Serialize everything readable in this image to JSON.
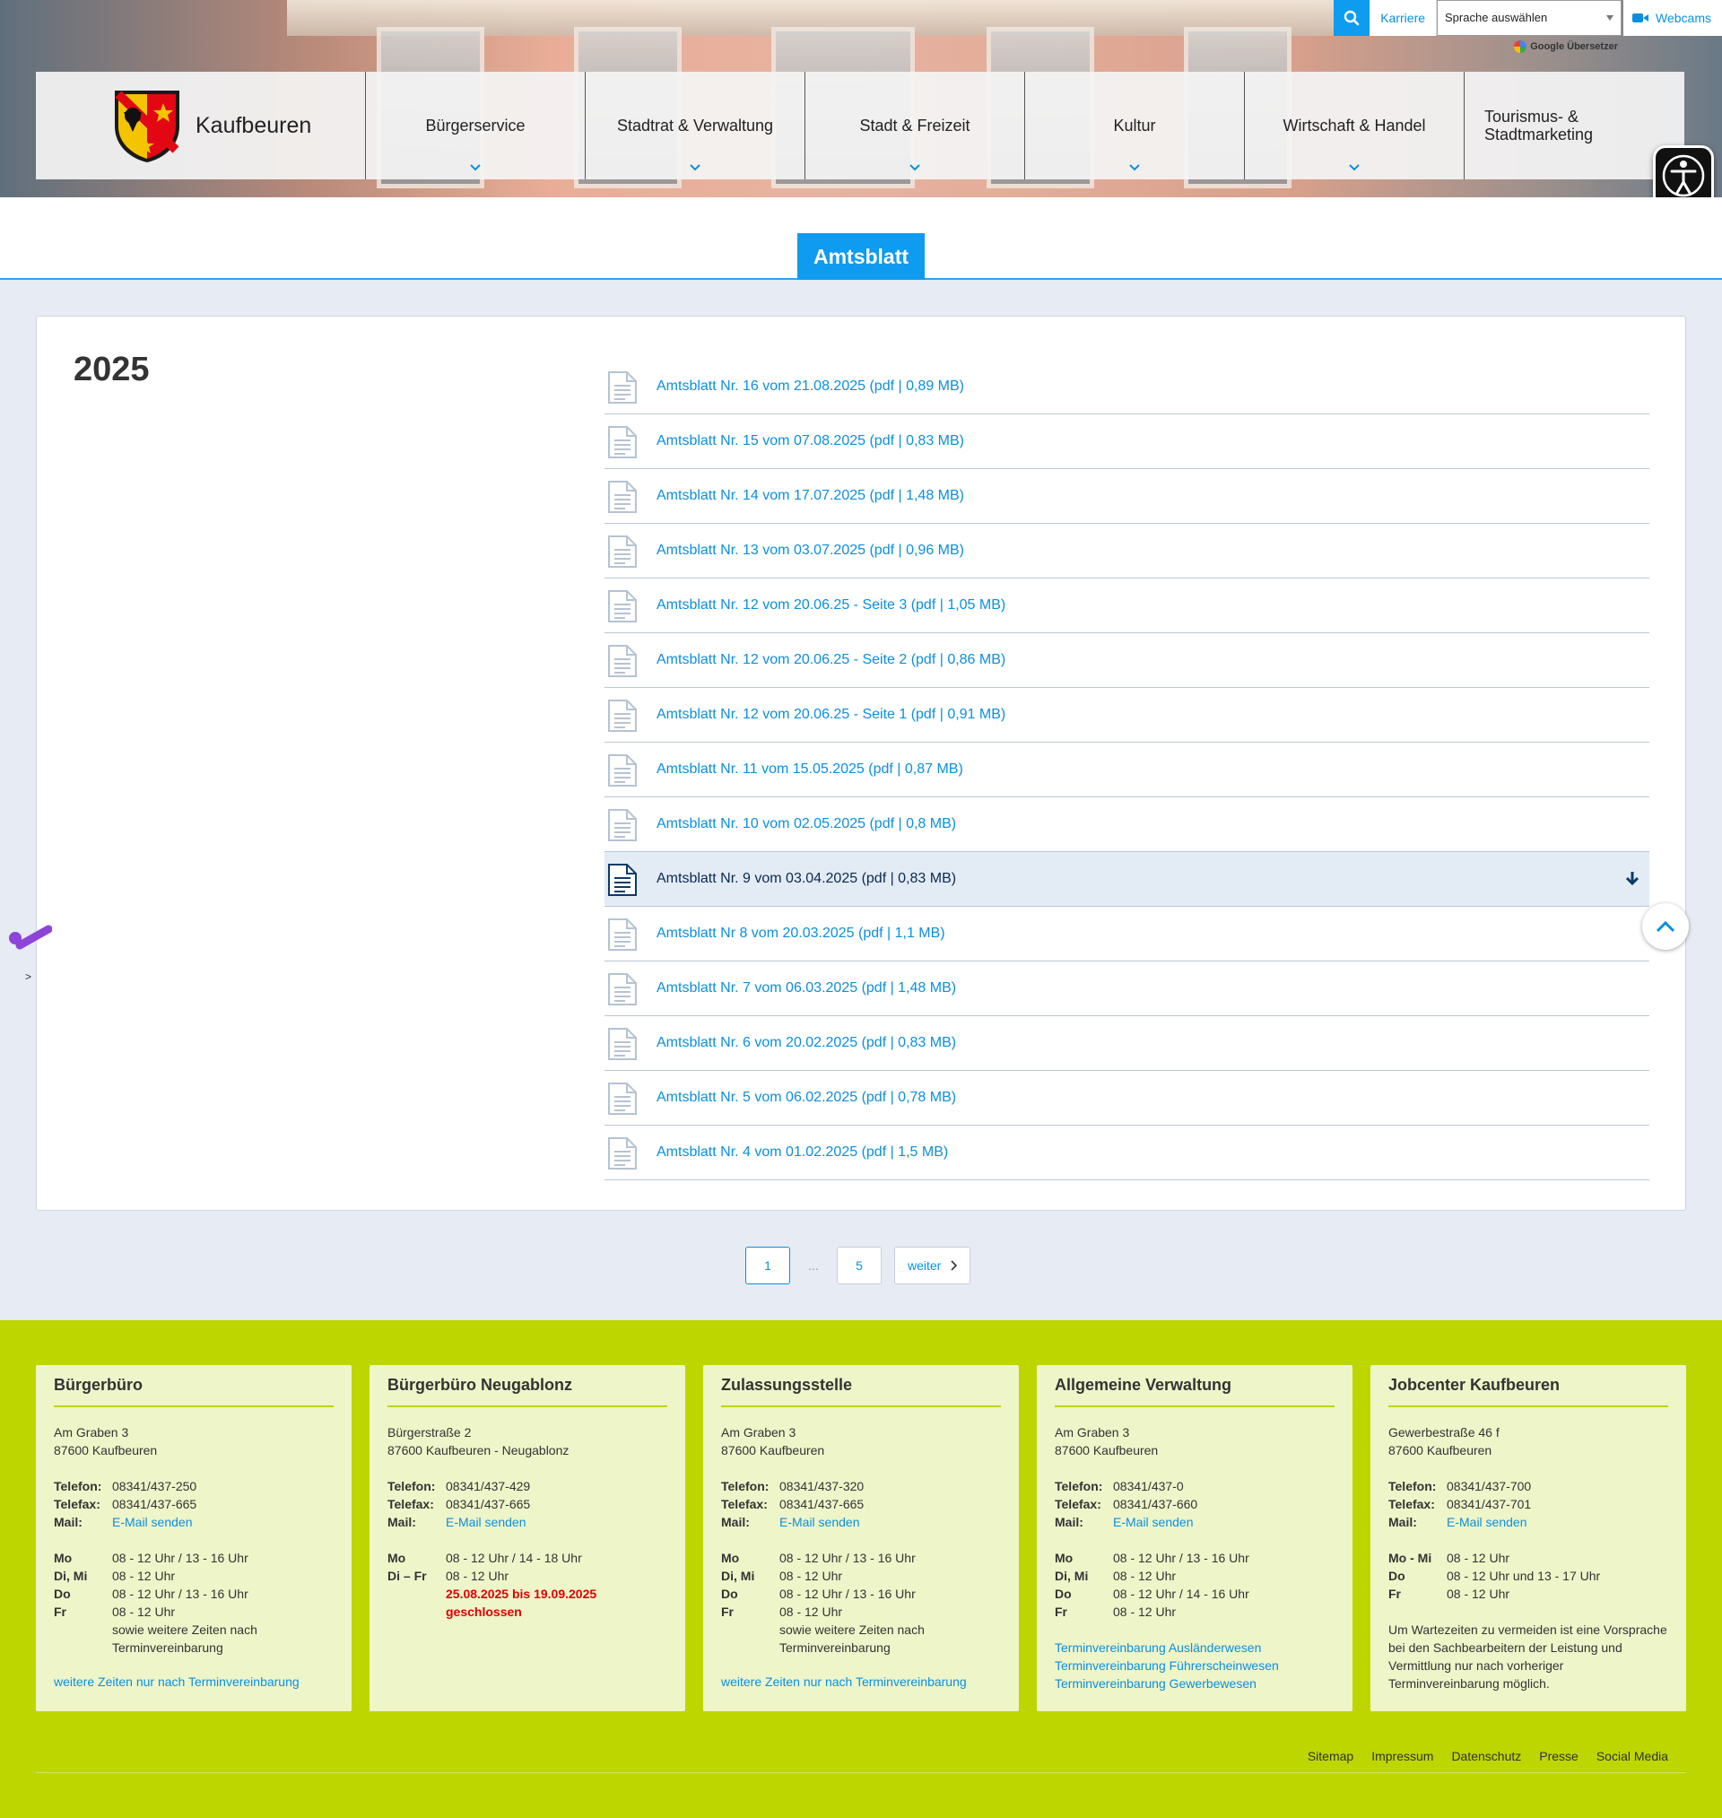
{
  "topbar": {
    "karriere": "Karriere",
    "language_select": "Sprache auswählen",
    "webcams": "Webcams",
    "google_translate": "Google Übersetzer"
  },
  "logo": {
    "brand": "Kaufbeuren"
  },
  "nav": {
    "items": [
      {
        "label": "Bürgerservice"
      },
      {
        "label": "Stadtrat & Verwaltung"
      },
      {
        "label": "Stadt & Freizeit"
      },
      {
        "label": "Kultur"
      },
      {
        "label": "Wirtschaft & Handel"
      },
      {
        "label": "Tourismus- & Stadtmarketing"
      }
    ]
  },
  "page": {
    "title": "Amtsblatt",
    "year": "2025"
  },
  "documents": [
    {
      "label": "Amtsblatt Nr. 16 vom 21.08.2025 (pdf | 0,89 MB)"
    },
    {
      "label": "Amtsblatt Nr. 15 vom 07.08.2025 (pdf | 0,83 MB)"
    },
    {
      "label": "Amtsblatt Nr. 14 vom 17.07.2025 (pdf | 1,48 MB)"
    },
    {
      "label": "Amtsblatt Nr. 13 vom 03.07.2025 (pdf | 0,96 MB)"
    },
    {
      "label": "Amtsblatt Nr. 12 vom 20.06.25 - Seite 3 (pdf | 1,05 MB)"
    },
    {
      "label": "Amtsblatt Nr. 12 vom 20.06.25 - Seite 2 (pdf | 0,86 MB)"
    },
    {
      "label": "Amtsblatt Nr. 12 vom 20.06.25 - Seite 1 (pdf | 0,91 MB)"
    },
    {
      "label": "Amtsblatt Nr. 11 vom 15.05.2025 (pdf | 0,87 MB)"
    },
    {
      "label": "Amtsblatt Nr. 10 vom 02.05.2025 (pdf | 0,8 MB)"
    },
    {
      "label": "Amtsblatt Nr. 9 vom 03.04.2025 (pdf | 0,83 MB)"
    },
    {
      "label": "Amtsblatt Nr 8 vom 20.03.2025 (pdf | 1,1 MB)"
    },
    {
      "label": "Amtsblatt Nr. 7 vom 06.03.2025 (pdf | 1,48 MB)"
    },
    {
      "label": "Amtsblatt Nr. 6 vom 20.02.2025 (pdf | 0,83 MB)"
    },
    {
      "label": "Amtsblatt Nr. 5 vom 06.02.2025 (pdf | 0,78 MB)"
    },
    {
      "label": "Amtsblatt Nr. 4 vom 01.02.2025 (pdf | 1,5 MB)"
    }
  ],
  "pagination": {
    "page1": "1",
    "dots": "...",
    "page5": "5",
    "next": "weiter"
  },
  "misc": {
    "caret": ">"
  },
  "footer": {
    "cards": [
      {
        "title": "Bürgerbüro",
        "addr1": "Am Graben 3",
        "addr2": "87600 Kaufbeuren",
        "tel_k": "Telefon:",
        "tel": "08341/437-250",
        "fax_k": "Telefax:",
        "fax": "08341/437-665",
        "mail_k": "Mail:",
        "mail": "E-Mail senden",
        "h1_k": "Mo",
        "h1": "08 - 12 Uhr / 13 - 16 Uhr",
        "h2_k": "Di, Mi",
        "h2": "08 - 12 Uhr",
        "h3_k": "Do",
        "h3": "08 - 12 Uhr / 13 - 16 Uhr",
        "h4_k": "Fr",
        "h4": "08 - 12 Uhr",
        "h5": "sowie weitere Zeiten nach Terminvereinbarung",
        "link": "weitere Zeiten nur nach Terminvereinbarung"
      },
      {
        "title": "Bürgerbüro Neugablonz",
        "addr1": "Bürgerstraße 2",
        "addr2": "87600 Kaufbeuren - Neugablonz",
        "tel_k": "Telefon:",
        "tel": "08341/437-429",
        "fax_k": "Telefax:",
        "fax": "08341/437-665",
        "mail_k": "Mail:",
        "mail": "E-Mail senden",
        "h1_k": "Mo",
        "h1": "08 - 12 Uhr / 14 - 18 Uhr",
        "h2_k": "Di – Fr",
        "h2": "08 - 12 Uhr",
        "closed": "25.08.2025 bis 19.09.2025 geschlossen"
      },
      {
        "title": "Zulassungsstelle",
        "addr1": "Am Graben 3",
        "addr2": "87600 Kaufbeuren",
        "tel_k": "Telefon:",
        "tel": "08341/437-320",
        "fax_k": "Telefax:",
        "fax": "08341/437-665",
        "mail_k": "Mail:",
        "mail": "E-Mail senden",
        "h1_k": "Mo",
        "h1": "08 - 12 Uhr / 13 - 16 Uhr",
        "h2_k": "Di, Mi",
        "h2": "08 - 12 Uhr",
        "h3_k": "Do",
        "h3": "08 - 12 Uhr / 13 - 16 Uhr",
        "h4_k": "Fr",
        "h4": "08 - 12 Uhr",
        "h5": "sowie weitere Zeiten nach Terminvereinbarung",
        "link": "weitere Zeiten nur nach Terminvereinbarung"
      },
      {
        "title": "Allgemeine Verwaltung",
        "addr1": "Am Graben 3",
        "addr2": "87600 Kaufbeuren",
        "tel_k": "Telefon:",
        "tel": "08341/437-0",
        "fax_k": "Telefax:",
        "fax": "08341/437-660",
        "mail_k": "Mail:",
        "mail": "E-Mail senden",
        "h1_k": "Mo",
        "h1": "08 - 12 Uhr / 13 - 16 Uhr",
        "h2_k": "Di, Mi",
        "h2": "08 - 12 Uhr",
        "h3_k": "Do",
        "h3": "08 - 12 Uhr / 14 - 16 Uhr",
        "h4_k": "Fr",
        "h4": "08 - 12 Uhr",
        "links": [
          "Terminvereinbarung Ausländerwesen",
          "Terminvereinbarung Führerscheinwesen",
          "Terminvereinbarung Gewerbewesen"
        ]
      },
      {
        "title": "Jobcenter Kaufbeuren",
        "addr1": "Gewerbestraße 46 f",
        "addr2": "87600 Kaufbeuren",
        "tel_k": "Telefon:",
        "tel": "08341/437-700",
        "fax_k": "Telefax:",
        "fax": "08341/437-701",
        "mail_k": "Mail:",
        "mail": "E-Mail senden",
        "h1_k": "Mo - Mi",
        "h1": "08 - 12 Uhr",
        "h2_k": "Do",
        "h2": "08 - 12 Uhr und 13 - 17 Uhr",
        "h3_k": "Fr",
        "h3": "08 - 12 Uhr",
        "note": "Um Wartezeiten zu vermeiden ist eine Vorsprache bei den Sachbearbeitern der Leistung und Vermittlung nur nach vorheriger Terminvereinbarung möglich."
      }
    ],
    "links": [
      "Sitemap",
      "Impressum",
      "Datenschutz",
      "Presse",
      "Social Media"
    ]
  },
  "colors": {
    "accent": "#0f9bf0",
    "footer": "#bdd600",
    "card": "#eef5c9",
    "highlight": "#e3ebf5"
  }
}
